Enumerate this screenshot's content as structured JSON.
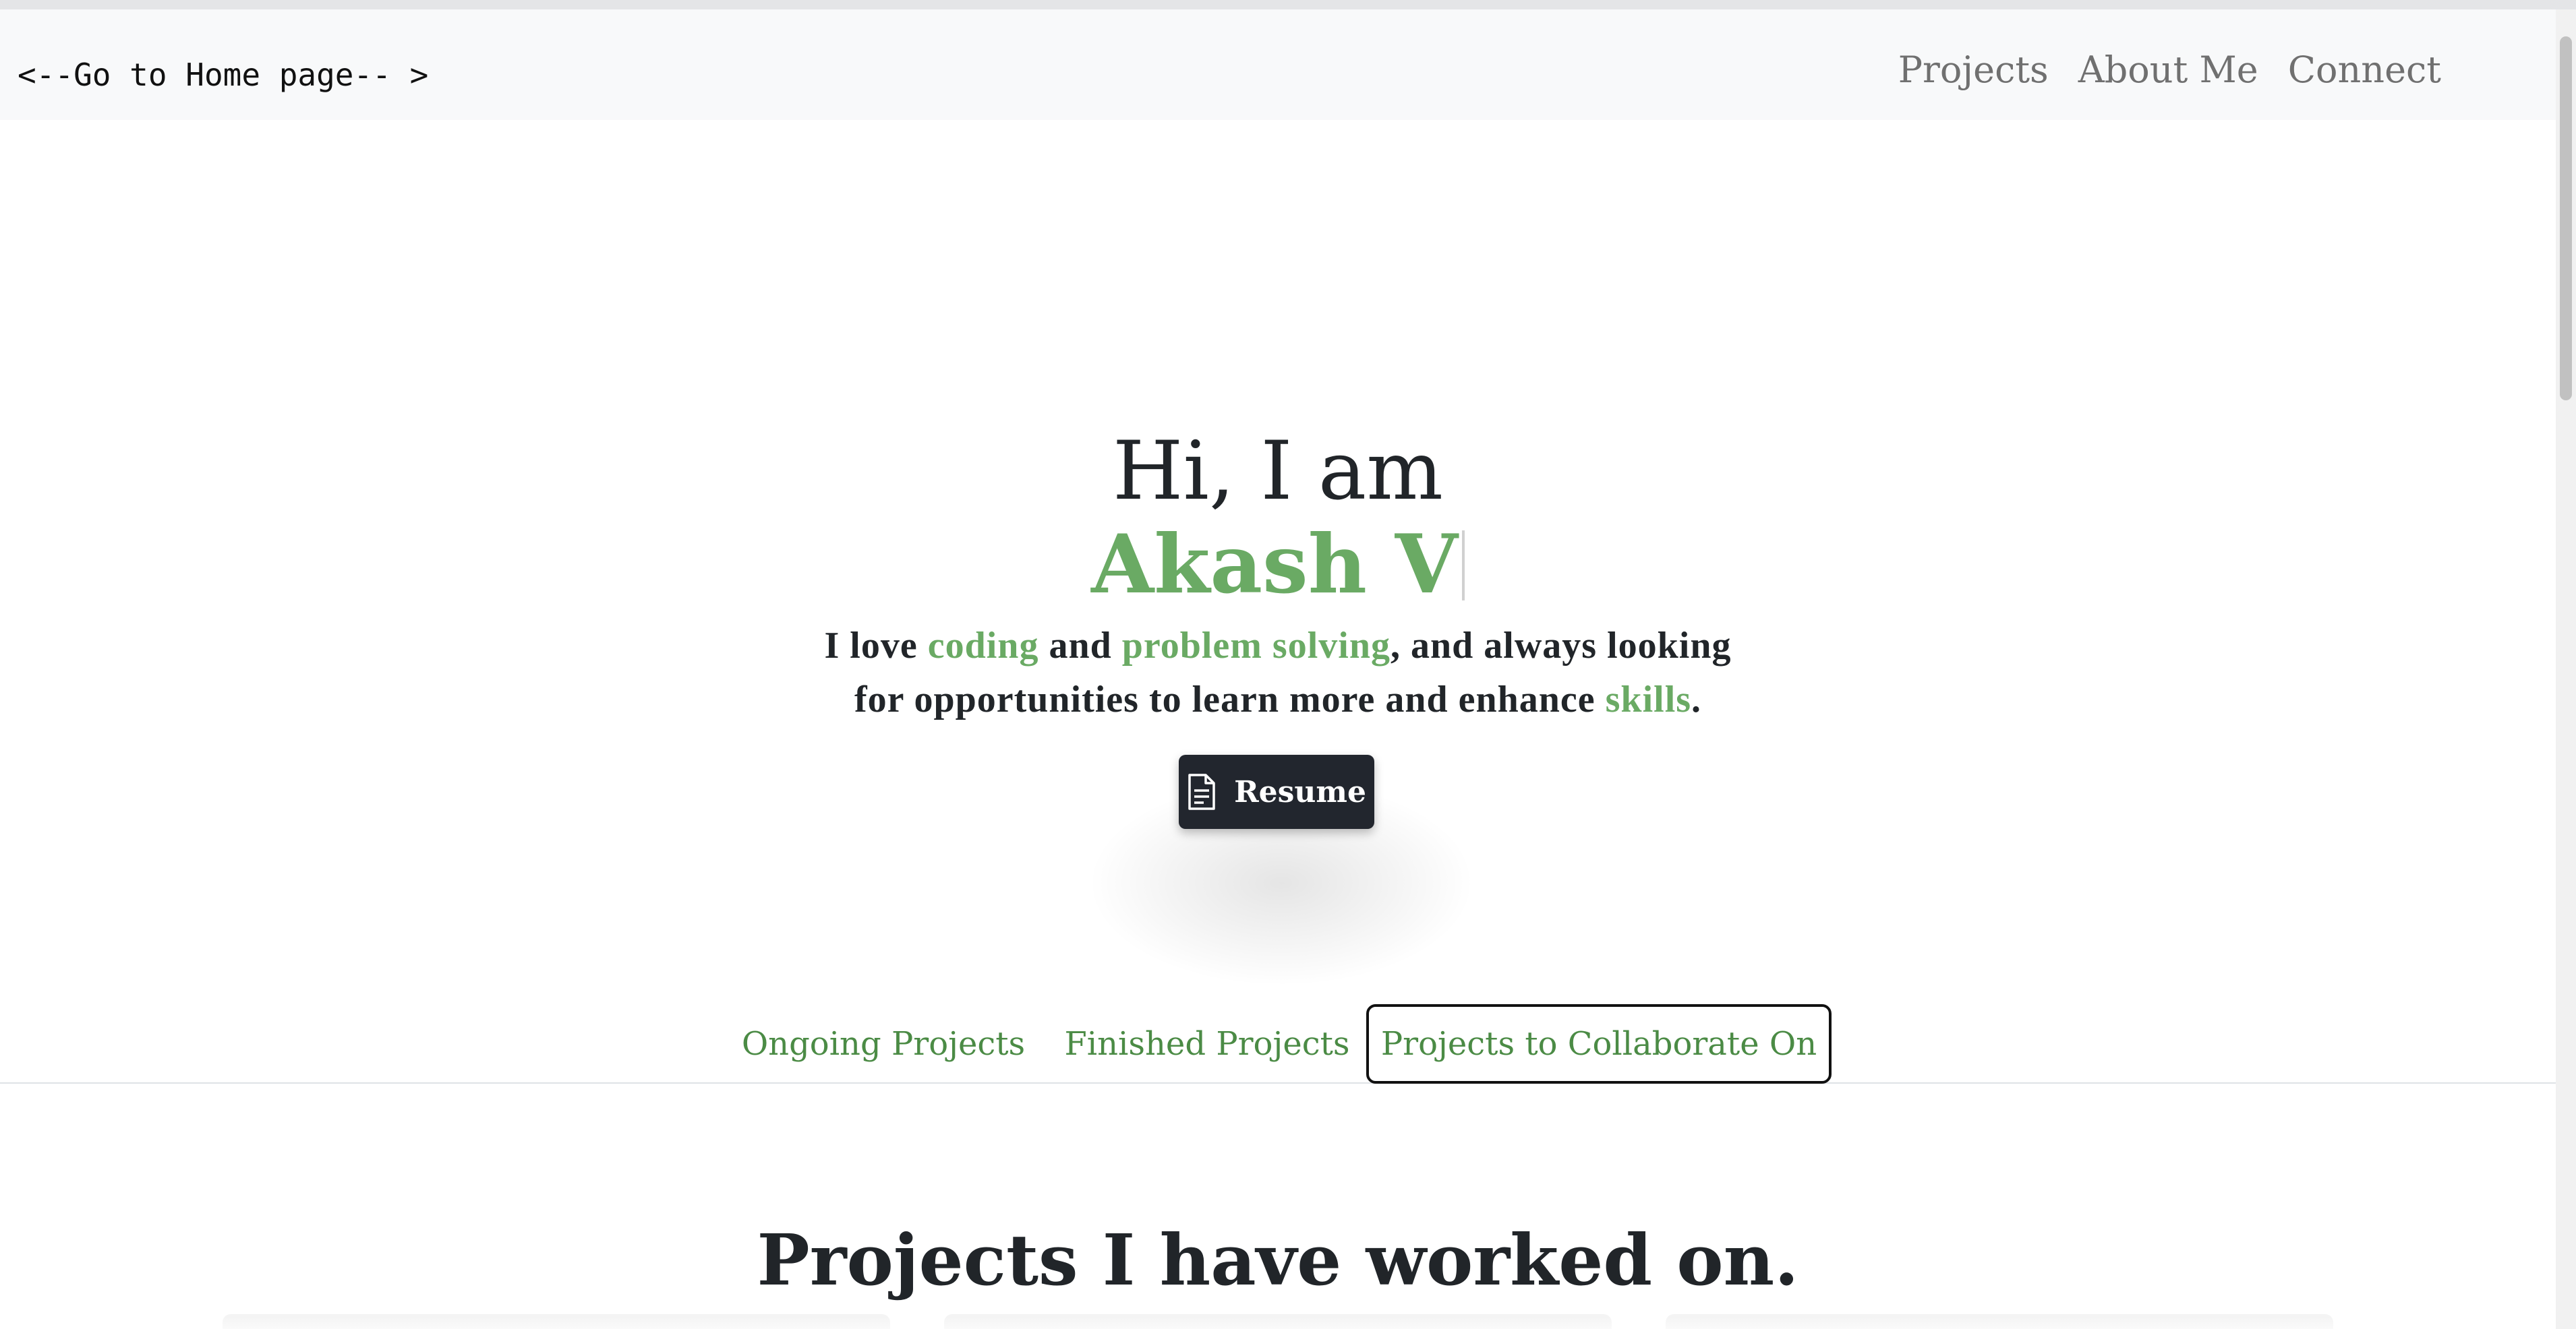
{
  "navbar": {
    "home_link": "<--Go to Home page-- >",
    "links": [
      "Projects",
      "About Me",
      "Connect"
    ]
  },
  "hero": {
    "greeting": "Hi, I am",
    "name": "Akash V",
    "text_parts": [
      "I love ",
      "coding",
      " and ",
      "problem solving",
      ", and always looking",
      "for opportunities to learn more and enhance ",
      "skills",
      "."
    ],
    "resume_label": "Resume",
    "resume_icon": "document-icon"
  },
  "tabs": [
    "Ongoing Projects",
    "Finished Projects",
    "Projects to Collaborate On"
  ],
  "active_tab": "Projects to Collaborate On",
  "section": {
    "title": "Projects I have worked on."
  },
  "colors": {
    "accent": "#6aaa64",
    "tab_text": "#4b8b45",
    "button_bg": "#22262e",
    "navbar_bg": "#f8f9fa"
  }
}
